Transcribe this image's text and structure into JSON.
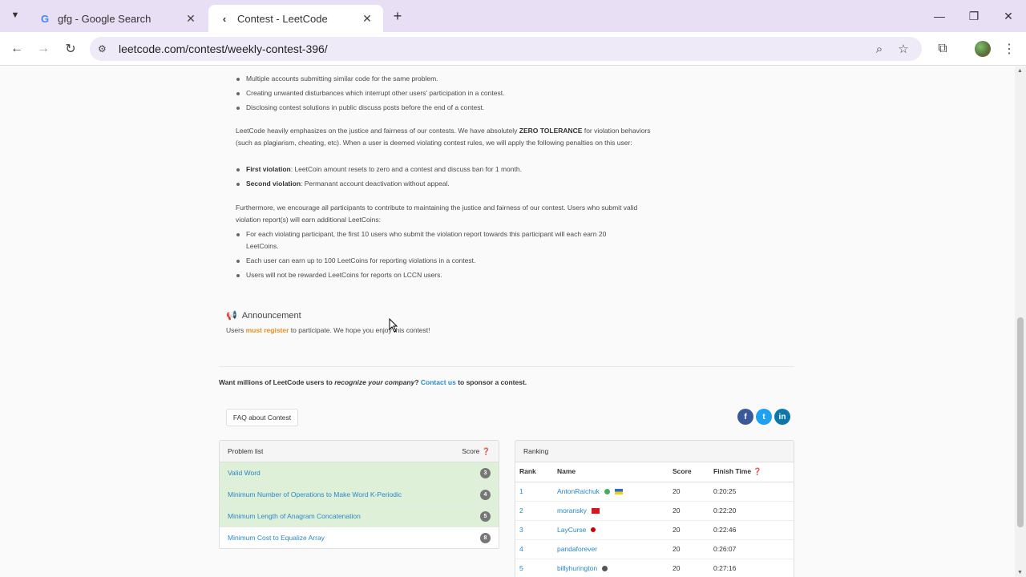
{
  "browser": {
    "tabs": [
      {
        "title": "gfg - Google Search",
        "favicon": "google-icon",
        "active": false
      },
      {
        "title": "Contest - LeetCode",
        "favicon": "leetcode-icon",
        "active": true
      }
    ],
    "url": "leetcode.com/contest/weekly-contest-396/"
  },
  "rules": {
    "list1": [
      "Multiple accounts submitting similar code for the same problem.",
      "Creating unwanted disturbances which interrupt other users' participation in a contest.",
      "Disclosing contest solutions in public discuss posts before the end of a contest."
    ],
    "para1_prefix": "LeetCode heavily emphasizes on the justice and fairness of our contests. We have absolutely ",
    "para1_bold": "ZERO TOLERANCE",
    "para1_suffix": " for violation behaviors (such as plagiarism, cheating, etc). When a user is deemed violating contest rules, we will apply the following penalties on this user:",
    "penalties": [
      {
        "label": "First violation",
        "text": ": LeetCoin amount resets to zero and a contest and discuss ban for 1 month."
      },
      {
        "label": "Second violation",
        "text": ": Permanant account deactivation without appeal."
      }
    ],
    "para2": "Furthermore, we encourage all participants to contribute to maintaining the justice and fairness of our contest. Users who submit valid violation report(s) will earn additional LeetCoins:",
    "list2": [
      "For each violating participant, the first 10 users who submit the violation report towards this participant will each earn 20 LeetCoins.",
      "Each user can earn up to 100 LeetCoins for reporting violations in a contest.",
      "Users will not be rewarded LeetCoins for reports on LCCN users."
    ]
  },
  "announcement": {
    "title": "Announcement",
    "text_prefix": "Users ",
    "text_highlight": "must register",
    "text_suffix": " to participate. We hope you enjoy this contest!"
  },
  "sponsor": {
    "prefix": "Want millions of LeetCode users to ",
    "italic": "recognize your company",
    "middle": "? ",
    "link": "Contact us",
    "suffix": " to sponsor a contest."
  },
  "faq_label": "FAQ about Contest",
  "social": {
    "facebook": {
      "label": "f",
      "color": "#3b5998"
    },
    "twitter": {
      "label": "t",
      "color": "#1da1f2"
    },
    "linkedin": {
      "label": "in",
      "color": "#0e76a8"
    }
  },
  "problems": {
    "header": "Problem list",
    "score_header": "Score",
    "items": [
      {
        "name": "Valid Word",
        "score": "3",
        "solved": true
      },
      {
        "name": "Minimum Number of Operations to Make Word K-Periodic",
        "score": "4",
        "solved": true
      },
      {
        "name": "Minimum Length of Anagram Concatenation",
        "score": "5",
        "solved": true
      },
      {
        "name": "Minimum Cost to Equalize Array",
        "score": "8",
        "solved": false
      }
    ]
  },
  "ranking": {
    "header": "Ranking",
    "columns": [
      "Rank",
      "Name",
      "Score",
      "Finish Time"
    ],
    "rows": [
      {
        "rank": "1",
        "name": "AntonRaichuk",
        "score": "20",
        "time": "0:20:25"
      },
      {
        "rank": "2",
        "name": "moransky",
        "score": "20",
        "time": "0:22:20"
      },
      {
        "rank": "3",
        "name": "LayCurse",
        "score": "20",
        "time": "0:22:46"
      },
      {
        "rank": "4",
        "name": "pandaforever",
        "score": "20",
        "time": "0:26:07"
      },
      {
        "rank": "5",
        "name": "billyhurington",
        "score": "20",
        "time": "0:27:16"
      }
    ]
  }
}
